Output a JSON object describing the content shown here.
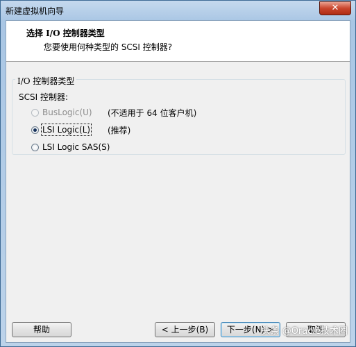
{
  "window": {
    "title": "新建虚拟机向导",
    "close_glyph": "✕"
  },
  "header": {
    "title": "选择 I/O 控制器类型",
    "subtitle": "您要使用何种类型的 SCSI 控制器?"
  },
  "group": {
    "title": "I/O 控制器类型",
    "scsi_label": "SCSI 控制器:",
    "options": [
      {
        "label": "BusLogic(U)",
        "note": "(不适用于 64 位客户机)",
        "checked": false,
        "disabled": true
      },
      {
        "label": "LSI Logic(L)",
        "note": "(推荐)",
        "checked": true,
        "disabled": false
      },
      {
        "label": "LSI Logic SAS(S)",
        "note": "",
        "checked": false,
        "disabled": false
      }
    ]
  },
  "buttons": {
    "help": "帮助",
    "back": "< 上一步(B)",
    "next": "下一步(N) >",
    "cancel": "取消"
  },
  "watermark": "头条 @Oracle技术圈",
  "colors": {
    "accent": "#3c7fb1",
    "close": "#c9452c"
  }
}
